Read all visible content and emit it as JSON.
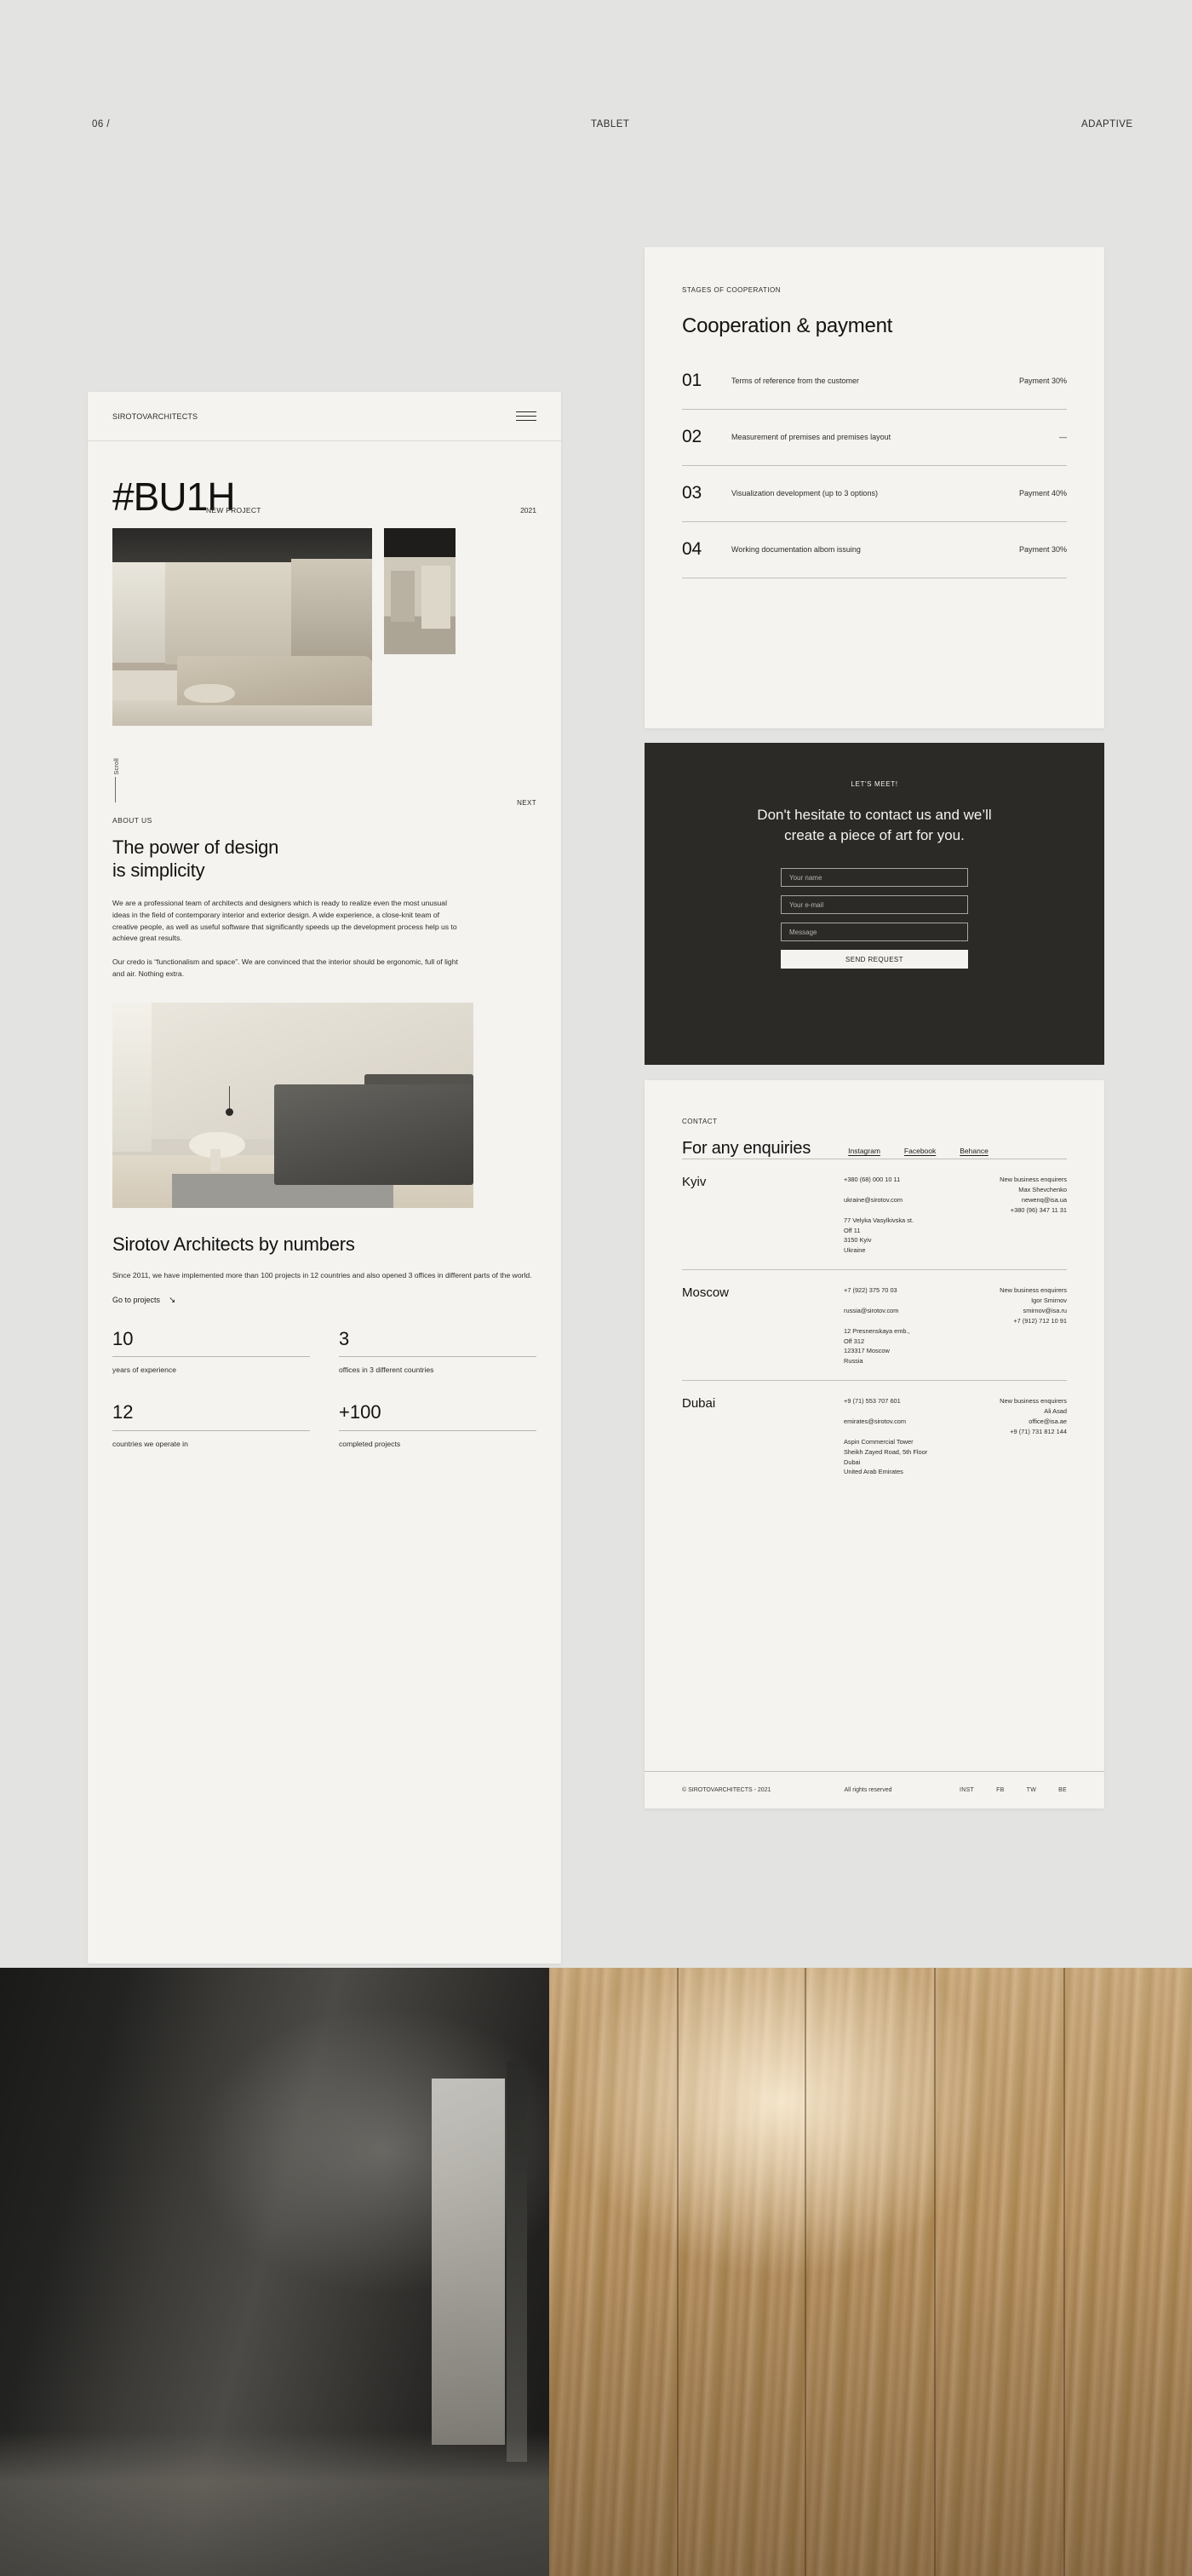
{
  "top_labels": {
    "left": "06 /",
    "center": "TABLET",
    "right": "ADAPTIVE"
  },
  "mobile": {
    "logo": "SIROTOVARCHITECTS",
    "menu_icon": "hamburger-icon",
    "hero": {
      "title": "#BU1H",
      "tag": "NEW PROJECT",
      "year": "2021"
    },
    "scroll_label": "Scroll",
    "next_label": "NEXT",
    "about": {
      "eyebrow": "ABOUT US",
      "title": "The power of design\nis simplicity",
      "paragraph1": "We are a professional team of architects and designers which is ready to realize even the most unusual ideas in the field of contemporary interior and exterior design. A wide experience, a close-knit team of creative people, as well as useful software that significantly speeds up the development process help us to achieve great results.",
      "paragraph2": "Our credo is “functionalism and space”. We are convinced that the interior should be ergonomic, full of light and air. Nothing extra."
    },
    "numbers": {
      "title": "Sirotov Architects by numbers",
      "paragraph": "Since 2011, we have implemented more than 100 projects in 12 countries and also opened 3 offices in different parts of the world.",
      "cta": "Go to projects",
      "cta_arrow": "↘",
      "stats": [
        {
          "value": "10",
          "label": "years of experience"
        },
        {
          "value": "3",
          "label": "offices in 3 different countries"
        },
        {
          "value": "12",
          "label": "countries we operate in"
        },
        {
          "value": "+100",
          "label": "completed projects"
        }
      ]
    }
  },
  "stages": {
    "eyebrow": "STAGES OF COOPERATION",
    "title": "Cooperation & payment",
    "rows": [
      {
        "num": "01",
        "text": "Terms of reference from the customer",
        "payment": "Payment 30%"
      },
      {
        "num": "02",
        "text": "Measurement of premises and premises layout",
        "payment": "—"
      },
      {
        "num": "03",
        "text": "Visualization development (up to 3 options)",
        "payment": "Payment 40%"
      },
      {
        "num": "04",
        "text": "Working documentation albom issuing",
        "payment": "Payment 30%"
      }
    ]
  },
  "cta": {
    "eyebrow": "LET'S MEET!",
    "heading": "Don't hesitate to contact us and we’ll create a piece of art for you.",
    "name_placeholder": "Your name",
    "email_placeholder": "Your e-mail",
    "message_placeholder": "Message",
    "button": "SEND REQUEST",
    "background": "#2b2a27"
  },
  "contact": {
    "eyebrow": "CONTACT",
    "title": "For any enquiries",
    "socials": [
      "Instagram",
      "Facebook",
      "Behance"
    ],
    "cities": [
      {
        "name": "Kyiv",
        "phone": "+380 (68) 000 10 11",
        "email": "ukraine@sirotov.com",
        "address": "77 Velyka Vasylkivska st.\nOff 11\n3150 Kyiv\nUkraine",
        "enquiries_label": "New business enquirers",
        "enquiries_person": "Max Shevchenko",
        "enquiries_email": "newenq@isa.ua",
        "enquiries_phone": "+380 (96) 347 11 31"
      },
      {
        "name": "Moscow",
        "phone": "+7 (922) 375 70 03",
        "email": "russia@sirotov.com",
        "address": "12 Presnenskaya emb.,\nOff 312\n123317 Moscow\nRussia",
        "enquiries_label": "New business enquirers",
        "enquiries_person": "Igor Smirnov",
        "enquiries_email": "smirnov@isa.ru",
        "enquiries_phone": "+7 (912) 712 10 91"
      },
      {
        "name": "Dubai",
        "phone": "+9 (71) 553 707 601",
        "email": "emirates@sirotov.com",
        "address": "Aspin Commercial Tower\nSheikh Zayed Road, 5th Floor\nDubai\nUnited Arab Emirates",
        "enquiries_label": "New business enquirers",
        "enquiries_person": "Ali Asad",
        "enquiries_email": "office@isa.ae",
        "enquiries_phone": "+9 (71) 731 812 144"
      }
    ],
    "footer": {
      "copyright": "© SIROTOVARCHITECTS - 2021",
      "rights": "All rights reserved",
      "socials": [
        "INST",
        "FB",
        "TW",
        "BE"
      ]
    }
  },
  "colors": {
    "page_bg": "#e3e3e2",
    "card_bg": "#f4f3ef",
    "dark": "#2b2a27",
    "ink": "#121211"
  }
}
